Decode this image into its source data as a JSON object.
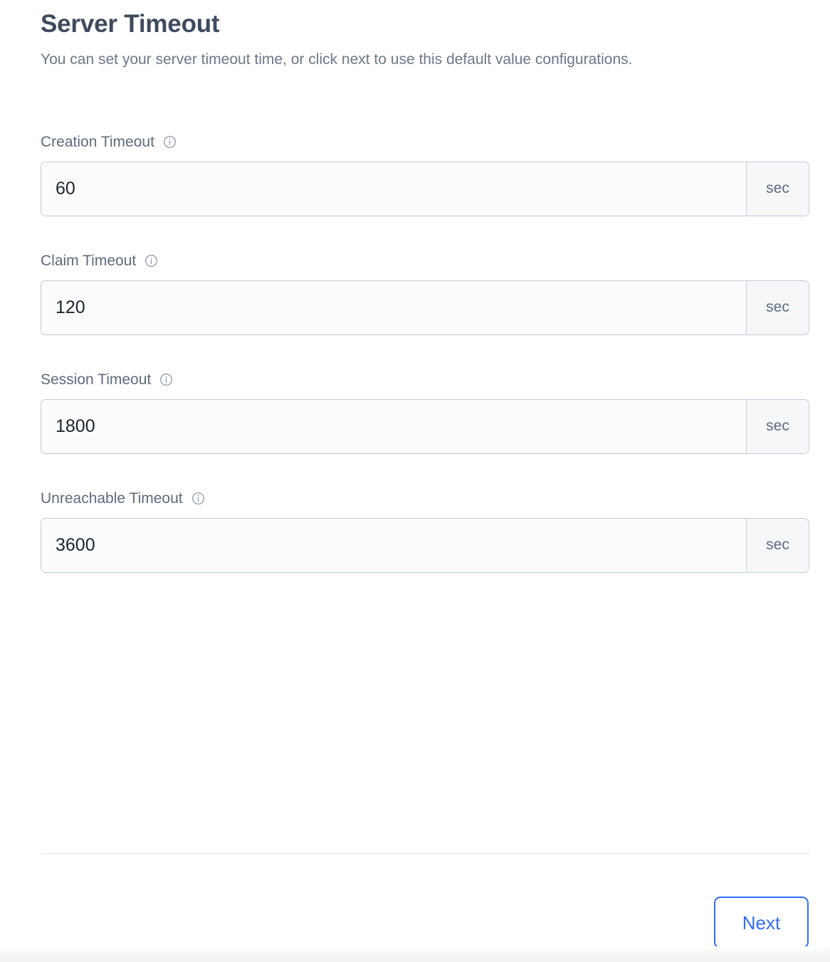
{
  "header": {
    "title": "Server Timeout",
    "description": "You can set your server timeout time, or click next to use this default value configurations."
  },
  "form": {
    "fields": [
      {
        "label": "Creation Timeout",
        "value": "60",
        "placeholder": "",
        "unit": "sec",
        "info_icon": "info-circle-icon"
      },
      {
        "label": "Claim Timeout",
        "value": "120",
        "placeholder": "",
        "unit": "sec",
        "info_icon": "info-circle-icon"
      },
      {
        "label": "Session Timeout",
        "value": "1800",
        "placeholder": "",
        "unit": "sec",
        "info_icon": "info-circle-icon"
      },
      {
        "label": "Unreachable Timeout",
        "value": "3600",
        "placeholder": "",
        "unit": "sec",
        "info_icon": "info-circle-icon"
      }
    ]
  },
  "footer": {
    "next_label": "Next"
  },
  "colors": {
    "title": "#3e4a5e",
    "description": "#6c7787",
    "label": "#5e6a7e",
    "input_value": "#1d2430",
    "input_border": "#c3cad8",
    "input_background": "#fafbfc",
    "addon_background": "#f5f7f9",
    "accent": "#2f6df6",
    "divider": "#e6e8ec",
    "page_background": "#ffffff"
  }
}
